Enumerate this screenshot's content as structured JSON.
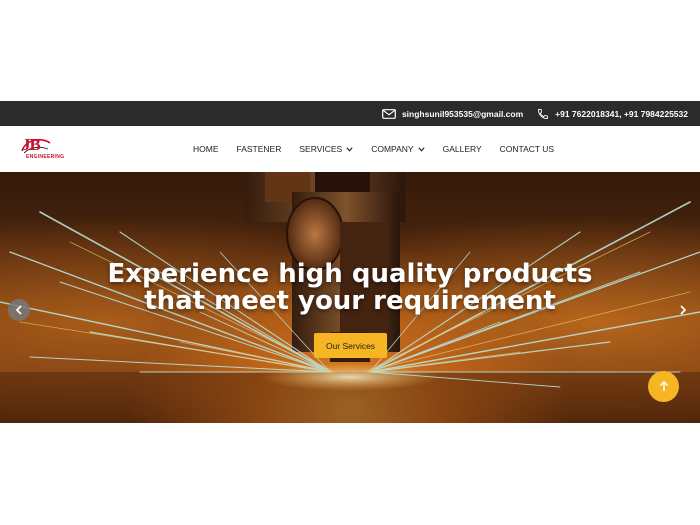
{
  "topbar": {
    "email": "singhsunil953535@gmail.com",
    "phone": "+91 7622018341,  +91 7984225532",
    "email_icon": "envelope-icon",
    "phone_icon": "phone-icon"
  },
  "header": {
    "logo": {
      "main": "JB",
      "sub": "ENGINEERING"
    },
    "nav": [
      {
        "label": "HOME",
        "dropdown": false
      },
      {
        "label": "FASTENER",
        "dropdown": false
      },
      {
        "label": "SERVICES",
        "dropdown": true
      },
      {
        "label": "COMPANY",
        "dropdown": true
      },
      {
        "label": "GALLERY",
        "dropdown": false
      },
      {
        "label": "CONTACT US",
        "dropdown": false
      }
    ]
  },
  "hero": {
    "title_line1": "Experience high quality products",
    "title_line2": "that meet your requirement",
    "cta_label": "Our Services",
    "prev_icon": "chevron-left-icon",
    "next_icon": "chevron-right-icon"
  },
  "scroll_top_icon": "arrow-up-icon",
  "colors": {
    "topbar_bg": "#2b2b2b",
    "accent": "#f6b623",
    "brand_red": "#c8102e"
  }
}
